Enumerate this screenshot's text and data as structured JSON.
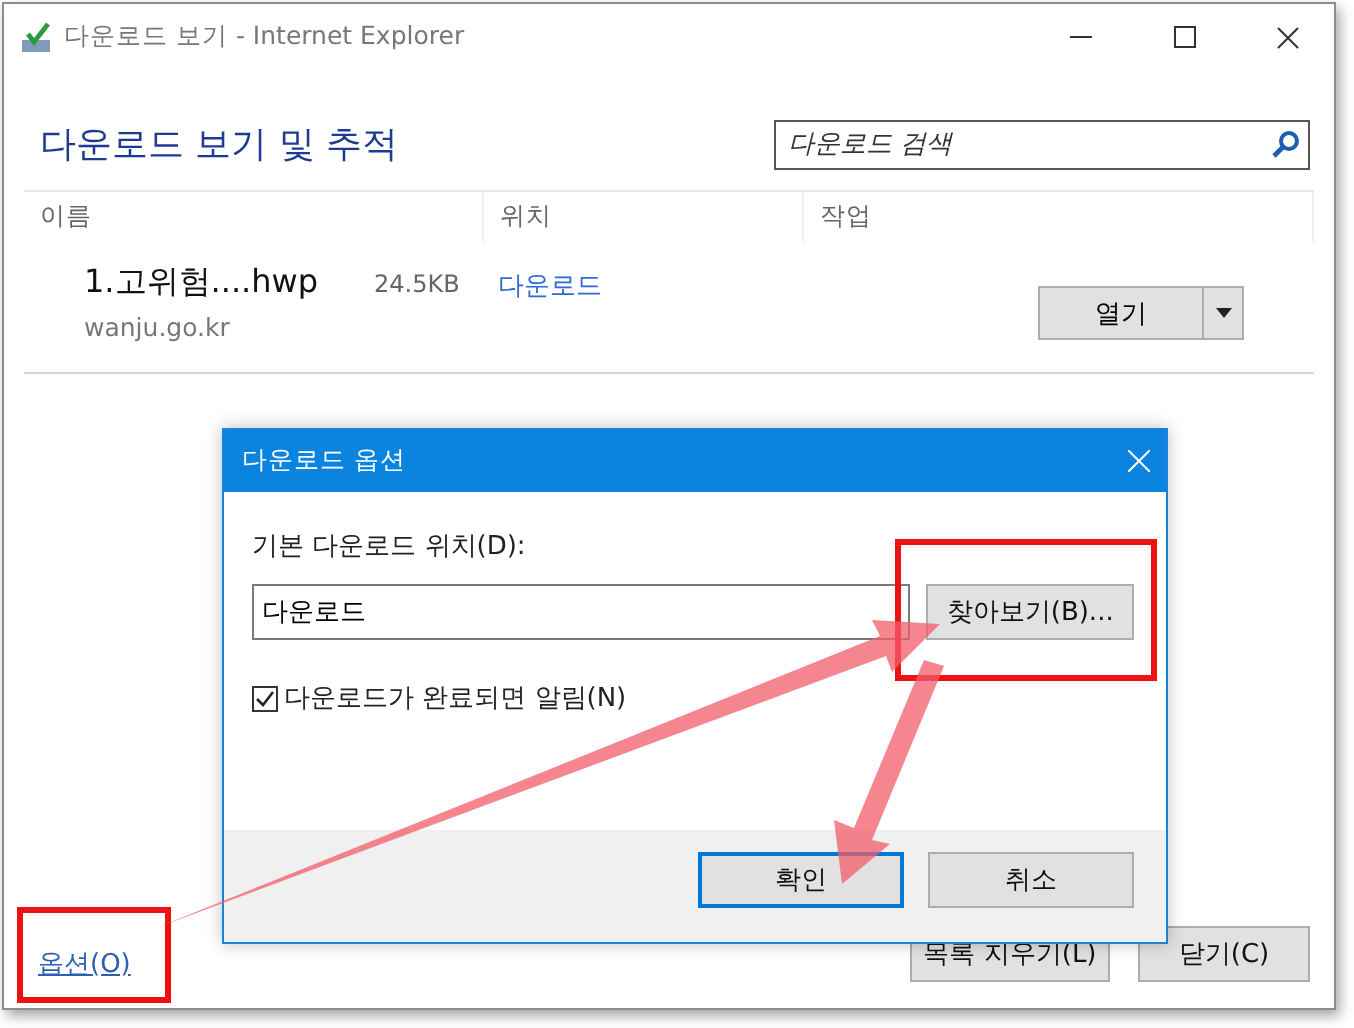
{
  "window": {
    "title": "다운로드 보기 - Internet Explorer"
  },
  "header": {
    "title": "다운로드 보기 및 추적",
    "search": {
      "placeholder": "다운로드 검색"
    }
  },
  "columns": [
    "이름",
    "위치",
    "작업"
  ],
  "downloads": [
    {
      "name": "1.고위험....hwp",
      "source": "wanju.go.kr",
      "size": "24.5KB",
      "location": "다운로드",
      "action": "열기"
    }
  ],
  "options_link": "옵션(O)",
  "buttons": [
    "목록 지우기(L)",
    "닫기(C)"
  ],
  "dialog": {
    "title": "다운로드 옵션",
    "location_label": "기본 다운로드 위치(D):",
    "location_value": "다운로드",
    "browse": "찾아보기(B)...",
    "notify": {
      "label": "다운로드가 완료되면 알림(N)",
      "checked": true
    },
    "buttons": [
      {
        "label": "확인",
        "default": true
      },
      {
        "label": "취소",
        "default": false
      }
    ]
  },
  "annotations": [
    {
      "kind": "box"
    },
    {
      "kind": "box"
    },
    {
      "kind": "arrow"
    },
    {
      "kind": "arrow"
    }
  ]
}
